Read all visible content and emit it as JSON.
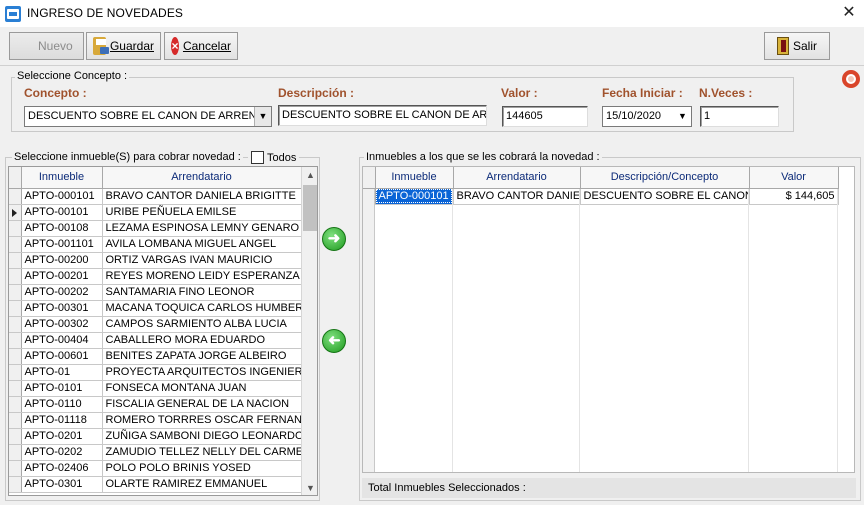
{
  "window": {
    "title": "INGRESO DE NOVEDADES",
    "close_label": "✕"
  },
  "toolbar": {
    "nuevo": "Nuevo",
    "guardar": "Guardar",
    "cancelar": "Cancelar",
    "salir": "Salir"
  },
  "concepto_group": {
    "legend": "Seleccione Concepto :",
    "concepto_label": "Concepto :",
    "concepto_value": "DESCUENTO SOBRE EL CANON DE ARRENDAMIENTO",
    "descripcion_label": "Descripción :",
    "descripcion_value": "DESCUENTO SOBRE EL CANON DE ARRENDAMIENTO",
    "valor_label": "Valor :",
    "valor_value": "144605",
    "fecha_label": "Fecha Iniciar :",
    "fecha_value": "15/10/2020",
    "nveces_label": "N.Veces :",
    "nveces_value": "1"
  },
  "left_panel": {
    "legend": "Seleccione inmueble(S) para cobrar novedad :",
    "todos_label": "Todos",
    "columns": [
      "Inmueble",
      "Arrendatario"
    ],
    "current_row": 1,
    "rows": [
      [
        "APTO-000101",
        "BRAVO CANTOR DANIELA BRIGITTE"
      ],
      [
        "APTO-00101",
        "URIBE PEÑUELA EMILSE"
      ],
      [
        "APTO-00108",
        "LEZAMA ESPINOSA LEMNY GENARO"
      ],
      [
        "APTO-001101",
        "AVILA LOMBANA MIGUEL ANGEL"
      ],
      [
        "APTO-00200",
        "ORTIZ VARGAS IVAN MAURICIO"
      ],
      [
        "APTO-00201",
        "REYES MORENO LEIDY ESPERANZA"
      ],
      [
        "APTO-00202",
        "SANTAMARIA FINO LEONOR"
      ],
      [
        "APTO-00301",
        "MACANA TOQUICA CARLOS HUMBERTO"
      ],
      [
        "APTO-00302",
        "CAMPOS SARMIENTO ALBA LUCIA"
      ],
      [
        "APTO-00404",
        "CABALLERO MORA EDUARDO"
      ],
      [
        "APTO-00601",
        "BENITES ZAPATA JORGE ALBEIRO"
      ],
      [
        "APTO-01",
        "PROYECTA ARQUITECTOS INGENIEROS"
      ],
      [
        "APTO-0101",
        "FONSECA MONTANA JUAN"
      ],
      [
        "APTO-0110",
        "FISCALIA GENERAL DE LA NACION"
      ],
      [
        "APTO-01118",
        "ROMERO TORRRES OSCAR FERNANDO"
      ],
      [
        "APTO-0201",
        "ZUÑIGA SAMBONI DIEGO LEONARDO"
      ],
      [
        "APTO-0202",
        "ZAMUDIO TELLEZ NELLY DEL CARMEN"
      ],
      [
        "APTO-02406",
        "POLO POLO BRINIS YOSED"
      ],
      [
        "APTO-0301",
        "OLARTE RAMIREZ EMMANUEL"
      ]
    ]
  },
  "right_panel": {
    "legend": "Inmuebles a los que se les cobrará la novedad :",
    "columns": [
      "Inmueble",
      "Arrendatario",
      "Descripción/Concepto",
      "Valor"
    ],
    "rows": [
      [
        "APTO-000101",
        "BRAVO CANTOR DANIELA BRIGITTE",
        "DESCUENTO SOBRE EL CANON DE ARRENDAMIENTO",
        "$ 144,605"
      ]
    ],
    "total_label": "Total Inmuebles Seleccionados :"
  },
  "colors": {
    "accent_label": "#a0522d",
    "header_text": "#0b2a78",
    "selection": "#0a64d6"
  },
  "icons": {
    "add_arrow": "arrow-right-icon",
    "remove_arrow": "arrow-left-icon"
  }
}
